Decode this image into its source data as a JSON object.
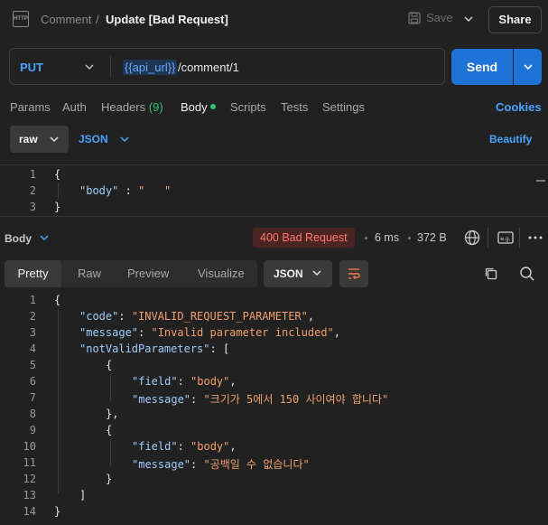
{
  "header": {
    "icon_text": "HTTP",
    "parent": "Comment",
    "separator": "/",
    "title": "Update [Bad Request]",
    "save_label": "Save",
    "share_label": "Share"
  },
  "request": {
    "method": "PUT",
    "url_variable": "{{api_url}}",
    "url_path": "/comment/1",
    "send_label": "Send"
  },
  "request_tabs": [
    {
      "label": "Params"
    },
    {
      "label": "Auth"
    },
    {
      "label": "Headers"
    },
    {
      "label": "Body"
    },
    {
      "label": "Scripts"
    },
    {
      "label": "Tests"
    },
    {
      "label": "Settings"
    }
  ],
  "headers_count": "(9)",
  "cookies_label": "Cookies",
  "body_options": {
    "mode": "raw",
    "language": "JSON",
    "beautify_label": "Beautify"
  },
  "request_body_lines": [
    {
      "n": "1",
      "text": "{"
    },
    {
      "n": "2",
      "key": "\"body\"",
      "colon": " : ",
      "value": "\"   \""
    },
    {
      "n": "3",
      "text": "}"
    }
  ],
  "response": {
    "section_label": "Body",
    "status": "400 Bad Request",
    "time": "6 ms",
    "size": "372 B",
    "tabs": [
      "Pretty",
      "Raw",
      "Preview",
      "Visualize"
    ],
    "format": "JSON"
  },
  "response_body_lines": [
    {
      "n": "1"
    },
    {
      "n": "2",
      "key": "\"code\"",
      "value": "\"INVALID_REQUEST_PARAMETER\""
    },
    {
      "n": "3",
      "key": "\"message\"",
      "value": "\"Invalid parameter included\""
    },
    {
      "n": "4",
      "key": "\"notValidParameters\""
    },
    {
      "n": "5"
    },
    {
      "n": "6",
      "key": "\"field\"",
      "value": "\"body\""
    },
    {
      "n": "7",
      "key": "\"message\"",
      "value": "\"크기가 5에서 150 사이여야 합니다\""
    },
    {
      "n": "8"
    },
    {
      "n": "9"
    },
    {
      "n": "10",
      "key": "\"field\"",
      "value": "\"body\""
    },
    {
      "n": "11",
      "key": "\"message\"",
      "value": "\"공백일 수 없습니다\""
    },
    {
      "n": "12"
    },
    {
      "n": "13"
    },
    {
      "n": "14"
    }
  ],
  "colors": {
    "accent": "#1f73d6",
    "link": "#4aa3ff",
    "error": "#ff7a6b",
    "json_key": "#9fcdfa",
    "json_string": "#f0a070"
  }
}
